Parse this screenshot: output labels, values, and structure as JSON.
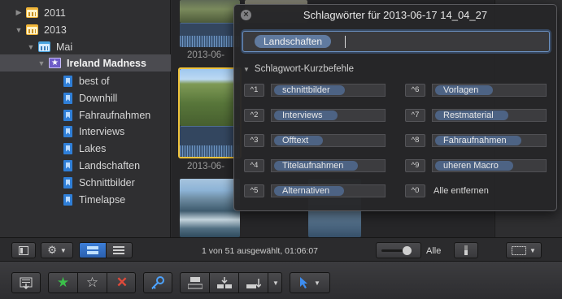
{
  "sidebar": {
    "items": [
      {
        "label": "2011",
        "icon": "calendar-icon",
        "level": 0
      },
      {
        "label": "2013",
        "icon": "calendar-icon",
        "level": 0
      },
      {
        "label": "Mai",
        "icon": "calendar-icon",
        "level": 1
      },
      {
        "label": "Ireland Madness",
        "icon": "event-star-icon",
        "level": 2,
        "selected": true
      },
      {
        "label": "best of",
        "icon": "keyword-icon",
        "level": 3
      },
      {
        "label": "Downhill",
        "icon": "keyword-icon",
        "level": 3
      },
      {
        "label": "Fahraufnahmen",
        "icon": "keyword-icon",
        "level": 3
      },
      {
        "label": "Interviews",
        "icon": "keyword-icon",
        "level": 3
      },
      {
        "label": "Lakes",
        "icon": "keyword-icon",
        "level": 3
      },
      {
        "label": "Landschaften",
        "icon": "keyword-icon",
        "level": 3
      },
      {
        "label": "Schnittbilder",
        "icon": "keyword-icon",
        "level": 3
      },
      {
        "label": "Timelapse",
        "icon": "keyword-icon",
        "level": 3
      }
    ]
  },
  "browser": {
    "captions": [
      "2013-06-",
      "2013-06-"
    ]
  },
  "hud": {
    "title": "Schlagwörter für 2013-06-17 14_04_27",
    "current_keyword": "Landschaften",
    "section_label": "Schlagwort-Kurzbefehle",
    "shortcuts_left": [
      {
        "key": "^1",
        "keyword": "schnittbilder"
      },
      {
        "key": "^2",
        "keyword": "Interviews"
      },
      {
        "key": "^3",
        "keyword": "Offtext"
      },
      {
        "key": "^4",
        "keyword": "Titelaufnahmen"
      },
      {
        "key": "^5",
        "keyword": "Alternativen"
      }
    ],
    "shortcuts_right": [
      {
        "key": "^6",
        "keyword": "Vorlagen"
      },
      {
        "key": "^7",
        "keyword": "Restmaterial"
      },
      {
        "key": "^8",
        "keyword": "Fahraufnahmen"
      },
      {
        "key": "^9",
        "keyword": "uheren Macro"
      },
      {
        "key": "^0",
        "keyword": "Alle entfernen"
      }
    ]
  },
  "statusbar": {
    "status": "1 von 51 ausgewählt, 01:06:07",
    "filter_label": "Alle"
  },
  "colors": {
    "accent": "#2f7fd8",
    "favorite": "#3bbf4a",
    "reject": "#e04a3a",
    "selection": "#4b4b50"
  }
}
